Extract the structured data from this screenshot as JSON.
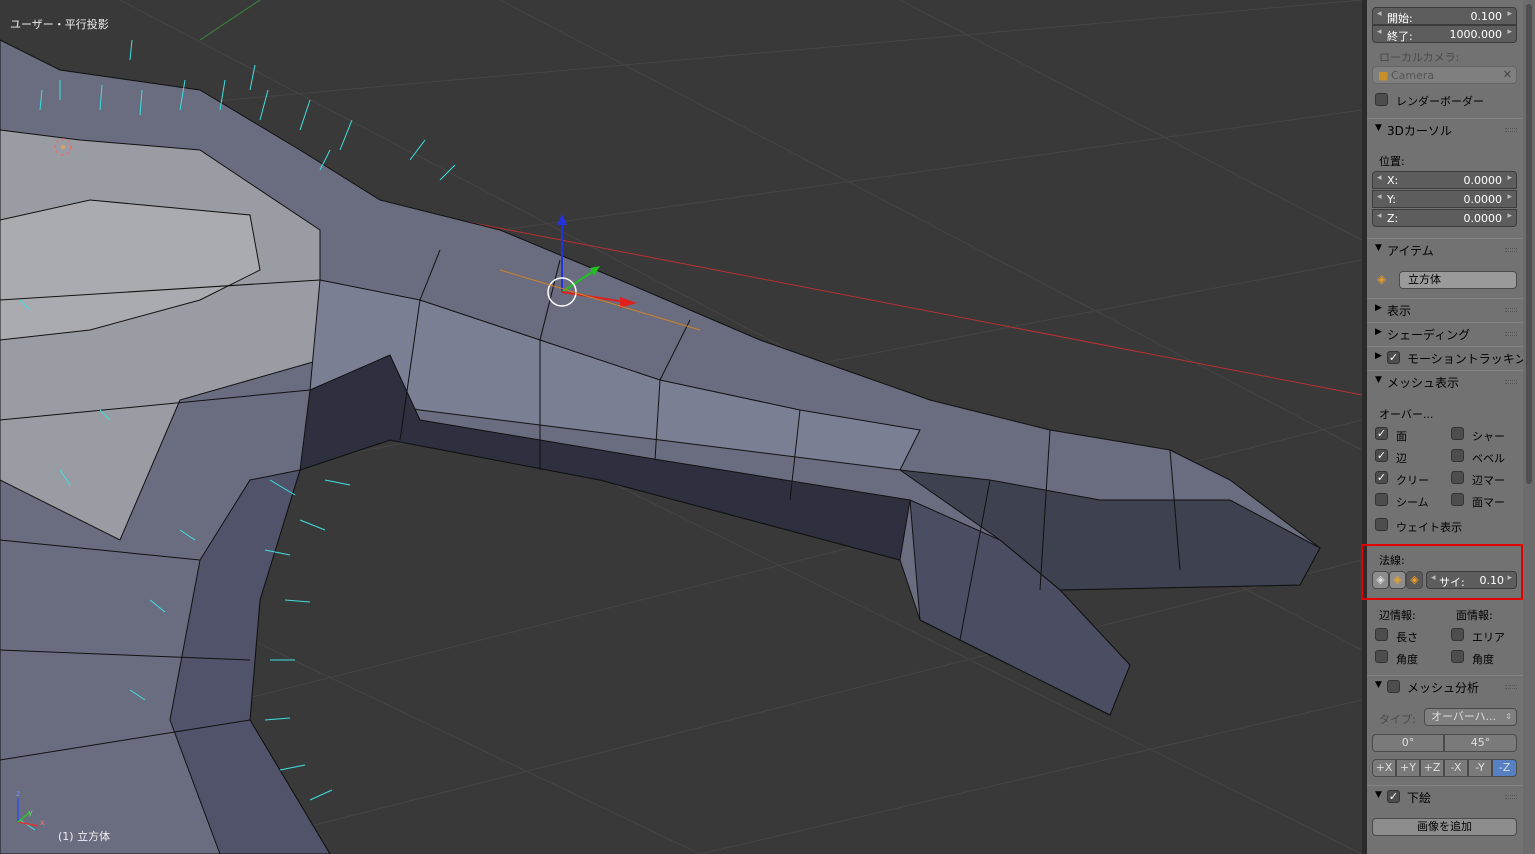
{
  "viewport": {
    "view_name": "ユーザー・平行投影",
    "object_label": "(1) 立方体",
    "axis_labels": {
      "x": "x",
      "y": "y",
      "z": "z"
    }
  },
  "panel": {
    "clip_start": {
      "label": "開始:",
      "value": "0.100"
    },
    "clip_end": {
      "label": "終了:",
      "value": "1000.000"
    },
    "local_camera_label": "ローカルカメラ:",
    "camera_field": "Camera",
    "render_border": "レンダーボーダー",
    "cursor_section": "3Dカーソル",
    "position_label": "位置:",
    "cursor_x": {
      "label": "X:",
      "value": "0.0000"
    },
    "cursor_y": {
      "label": "Y:",
      "value": "0.0000"
    },
    "cursor_z": {
      "label": "Z:",
      "value": "0.0000"
    },
    "item_section": "アイテム",
    "item_name": "立方体",
    "display_section": "表示",
    "shading_section": "シェーディング",
    "motion_tracking_section": "モーショントラッキン",
    "mesh_display_section": "メッシュ表示",
    "overlay_label": "オーバー...",
    "overlays": {
      "faces": "面",
      "edges": "辺",
      "crease": "クリー",
      "seams": "シーム",
      "sharp": "シャー",
      "bevel": "ベベル",
      "edge_marks": "辺マー",
      "face_marks": "面マー"
    },
    "weight_display": "ウェイト表示",
    "normals_label": "法線:",
    "normals_size": {
      "label": "サイ:",
      "value": "0.10"
    },
    "edge_info_label": "辺情報:",
    "face_info_label": "面情報:",
    "edge_length": "長さ",
    "edge_angle": "角度",
    "face_area": "エリア",
    "face_angle": "角度",
    "mesh_analysis_section": "メッシュ分析",
    "type_label": "タイプ:",
    "type_value": "オーバーハ...",
    "angle_min": "0°",
    "angle_max": "45°",
    "axes": [
      "+X",
      "+Y",
      "+Z",
      "-X",
      "-Y",
      "-Z"
    ],
    "background_section": "下絵",
    "add_image_button": "画像を追加"
  },
  "colors": {
    "accent_axis": "#5680c2",
    "highlight": "#e00000"
  }
}
